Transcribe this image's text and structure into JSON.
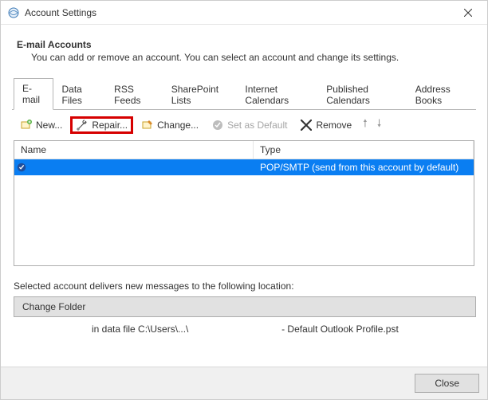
{
  "window": {
    "title": "Account Settings"
  },
  "header": {
    "heading": "E-mail Accounts",
    "subheading": "You can add or remove an account. You can select an account and change its settings."
  },
  "tabs": [
    {
      "label": "E-mail",
      "active": true
    },
    {
      "label": "Data Files",
      "active": false
    },
    {
      "label": "RSS Feeds",
      "active": false
    },
    {
      "label": "SharePoint Lists",
      "active": false
    },
    {
      "label": "Internet Calendars",
      "active": false
    },
    {
      "label": "Published Calendars",
      "active": false
    },
    {
      "label": "Address Books",
      "active": false
    }
  ],
  "toolbar": {
    "new": "New...",
    "repair": "Repair...",
    "change": "Change...",
    "set_default": "Set as Default",
    "remove": "Remove"
  },
  "list": {
    "columns": {
      "name": "Name",
      "type": "Type"
    },
    "rows": [
      {
        "name": "",
        "type": "POP/SMTP (send from this account by default)",
        "default": true
      }
    ]
  },
  "location": {
    "intro": "Selected account delivers new messages to the following location:",
    "change_folder": "Change Folder",
    "datafile_prefix": "in data file C:\\Users\\...\\",
    "datafile_suffix": "- Default Outlook Profile.pst"
  },
  "footer": {
    "close": "Close"
  }
}
